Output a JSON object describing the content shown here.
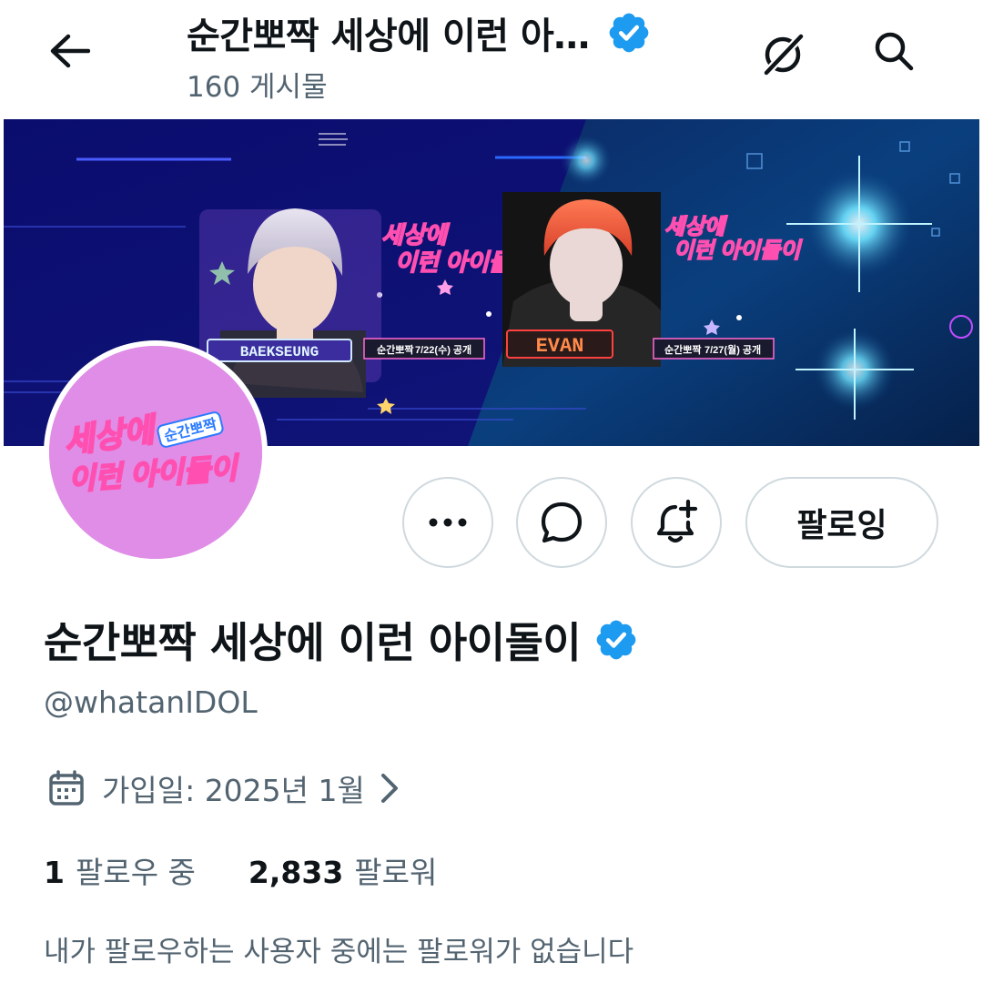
{
  "header": {
    "title": "순간뽀짝 세상에 이런 아…",
    "post_count": "160 게시물"
  },
  "banner": {
    "left_panel": {
      "name_tag": "BAEKSEUNG",
      "show_tag": "순간뽀짝",
      "date_tag": "7/22(수) 공개",
      "logo_line1": "세상에",
      "logo_line2": "이런 아이돌이"
    },
    "right_panel": {
      "name_tag": "EVAN",
      "show_tag": "순간뽀짝",
      "date_tag": "7/27(월) 공개",
      "logo_line1": "세상에",
      "logo_line2": "이런 아이돌이"
    }
  },
  "avatar": {
    "logo_line1": "세상에",
    "logo_line2": "이런 아이돌이",
    "logo_badge": "순간뽀짝"
  },
  "actions": {
    "follow_label": "팔로잉"
  },
  "profile": {
    "name": "순간뽀짝 세상에 이런 아이돌이",
    "handle": "@whatanIDOL",
    "joined": "가입일: 2025년 1월",
    "following_count": "1",
    "following_label": "팔로우 중",
    "followers_count": "2,833",
    "followers_label": "팔로워",
    "followers_note": "내가 팔로우하는 사용자 중에는 팔로워가 없습니다"
  },
  "colors": {
    "verified": "#1d9bf0",
    "text_primary": "#0f1419",
    "text_secondary": "#536471",
    "border": "#cfd9de",
    "avatar_bg": "#e08de8",
    "banner_bg": "#0b0f5c"
  },
  "icons": {
    "back": "arrow-left-icon",
    "grok": "grok-icon",
    "search": "search-icon",
    "verified": "verified-badge-icon",
    "more": "more-dots-icon",
    "message": "message-icon",
    "notify": "bell-plus-icon",
    "calendar": "calendar-icon",
    "chevron": "chevron-right-icon"
  }
}
